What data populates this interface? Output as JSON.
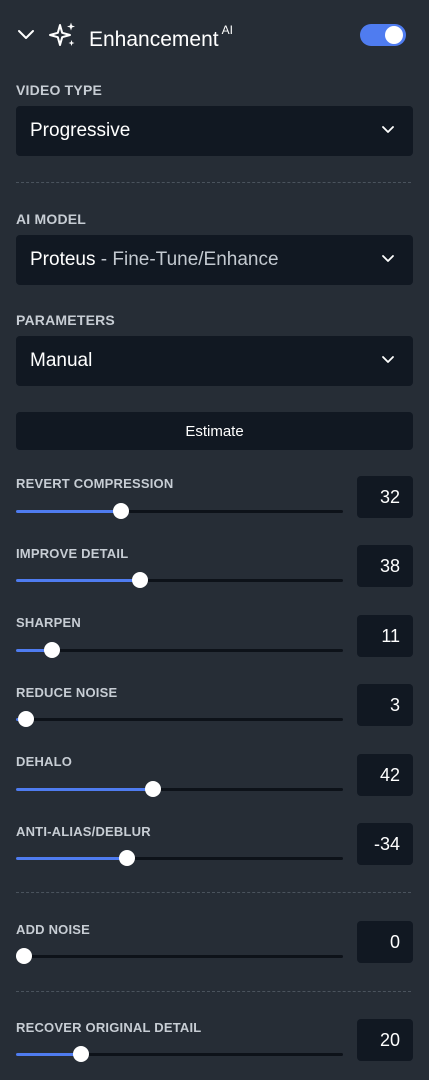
{
  "header": {
    "title": "Enhancement",
    "title_badge": "AI",
    "enabled": true,
    "accent_color": "#4f7cf0",
    "collapse_icon": "chevron-down-icon",
    "feature_icon": "sparkle-icon"
  },
  "video_type": {
    "label": "VIDEO TYPE",
    "value": "Progressive"
  },
  "ai_model": {
    "label": "AI MODEL",
    "value": "Proteus",
    "separator": " - ",
    "detail": "Fine-Tune/Enhance"
  },
  "parameters": {
    "label": "PARAMETERS",
    "value": "Manual"
  },
  "estimate_button": "Estimate",
  "sliders": [
    {
      "label": "REVERT COMPRESSION",
      "value": "32",
      "fraction": 0.32
    },
    {
      "label": "IMPROVE DETAIL",
      "value": "38",
      "fraction": 0.38
    },
    {
      "label": "SHARPEN",
      "value": "11",
      "fraction": 0.11
    },
    {
      "label": "REDUCE NOISE",
      "value": "3",
      "fraction": 0.03
    },
    {
      "label": "DEHALO",
      "value": "42",
      "fraction": 0.42
    },
    {
      "label": "ANTI-ALIAS/DEBLUR",
      "value": "-34",
      "fraction": 0.34
    }
  ],
  "add_noise": {
    "label": "ADD NOISE",
    "value": "0",
    "fraction": 0.0
  },
  "recover_detail": {
    "label": "RECOVER ORIGINAL DETAIL",
    "value": "20",
    "fraction": 0.2
  }
}
